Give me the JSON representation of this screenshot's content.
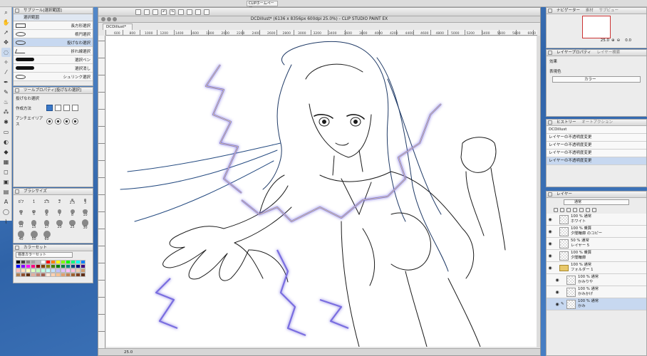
{
  "system_tab": "CLIPホームページ",
  "window": {
    "title": "DCDillust* (6136 x 8356px 600dpi 25.0%) - CLIP STUDIO PAINT EX",
    "doc_tab": "DCDillust*",
    "zoom": "25.0",
    "ruler_marks": [
      "600",
      "800",
      "1000",
      "1200",
      "1400",
      "1600",
      "1800",
      "2000",
      "2200",
      "2400",
      "2600",
      "2800",
      "3000",
      "3200",
      "3400",
      "3600",
      "3800",
      "4000",
      "4200",
      "4400",
      "4600",
      "4800",
      "5000",
      "5200",
      "5400",
      "5600",
      "5800",
      "6000"
    ]
  },
  "sub_tool": {
    "title": "サブツール[選択範囲]",
    "group": "選択範囲",
    "items": [
      {
        "label": "長方形選択",
        "shape": "rect"
      },
      {
        "label": "楕円選択",
        "shape": "ellipse"
      },
      {
        "label": "投げなわ選択",
        "shape": "lasso",
        "selected": true
      },
      {
        "label": "折れ線選択",
        "shape": "poly"
      },
      {
        "label": "選択ペン",
        "shape": "brush"
      },
      {
        "label": "選択消し",
        "shape": "brush"
      },
      {
        "label": "シュリンク選択",
        "shape": "lasso"
      }
    ]
  },
  "tool_property": {
    "title": "ツールプロパティ[投げなわ選択]",
    "tool_name": "投げなわ選択",
    "mode_label": "作成方法",
    "antialias_label": "アンチエイリアス"
  },
  "brush_size": {
    "title": "ブラシサイズ",
    "sizes": [
      "0.7",
      "1",
      "1.5",
      "2",
      "2.5",
      "3",
      "4",
      "5",
      "6",
      "7",
      "8",
      "10",
      "12",
      "15",
      "17",
      "20",
      "25",
      "30",
      "40",
      "50",
      "60"
    ]
  },
  "color_set": {
    "title": "カラーセット",
    "preset": "標準カラーセット",
    "colors": [
      "#000000",
      "#404040",
      "#808080",
      "#a0a0a0",
      "#c0c0c0",
      "#ffffff",
      "#ff0000",
      "#ff8000",
      "#ffff00",
      "#80ff00",
      "#00ff00",
      "#00ff80",
      "#00ffff",
      "#0080ff",
      "#0000ff",
      "#8000ff",
      "#ff00ff",
      "#ff0080",
      "#800000",
      "#804000",
      "#808000",
      "#408000",
      "#008000",
      "#008040",
      "#008080",
      "#004080",
      "#000080",
      "#400080",
      "#ffc0c0",
      "#ffe0c0",
      "#ffffc0",
      "#e0ffc0",
      "#c0ffc0",
      "#c0ffe0",
      "#c0ffff",
      "#c0e0ff",
      "#c0c0ff",
      "#e0c0ff",
      "#ffc0ff",
      "#ffc0e0",
      "#f0d0b0",
      "#d0a070",
      "#b08050",
      "#905030",
      "#603010",
      "#e0b0a0",
      "#c08070",
      "#a06050",
      "#ffe8d8",
      "#ffd0b0",
      "#f8c090",
      "#e0a070",
      "#c08050",
      "#a06030",
      "#804020",
      "#603018"
    ]
  },
  "navigator": {
    "title": "ナビゲーター",
    "tab2": "素材",
    "tab3": "サブビュー",
    "zoom": "25.0",
    "rotate": "0.0"
  },
  "layer_property": {
    "title": "レイヤープロパティ",
    "tab2": "レイヤー検索",
    "effect_label": "効果",
    "expression_label": "表現色",
    "expression_value": "カラー"
  },
  "history": {
    "title": "ヒストリー",
    "tab2": "オートアクション",
    "items": [
      {
        "label": "DCDillust"
      },
      {
        "label": "レイヤーの不透明度変更"
      },
      {
        "label": "レイヤーの不透明度変更"
      },
      {
        "label": "レイヤーの不透明度変更"
      },
      {
        "label": "レイヤーの不透明度変更",
        "selected": true
      }
    ]
  },
  "layers": {
    "title": "レイヤー",
    "blend": "通常",
    "rows": [
      {
        "line1": "100 % 通常",
        "line2": "ホワイト",
        "type": "layer"
      },
      {
        "line1": "100 % 乗算",
        "line2": "夕闇輪廓 のコピー",
        "type": "layer"
      },
      {
        "line1": "50 % 通常",
        "line2": "レイヤー 5",
        "type": "layer"
      },
      {
        "line1": "100 % 乗算",
        "line2": "夕闇輪廓",
        "type": "layer"
      },
      {
        "line1": "100 % 通常",
        "line2": "フォルダー 1",
        "type": "folder"
      },
      {
        "line1": "100 % 通常",
        "line2": "かみりや",
        "type": "layer",
        "indent": true
      },
      {
        "line1": "100 % 通常",
        "line2": "かみかげ",
        "type": "layer",
        "indent": true
      },
      {
        "line1": "100 % 通常",
        "line2": "かみ",
        "type": "layer",
        "indent": true,
        "selected": true
      }
    ]
  }
}
